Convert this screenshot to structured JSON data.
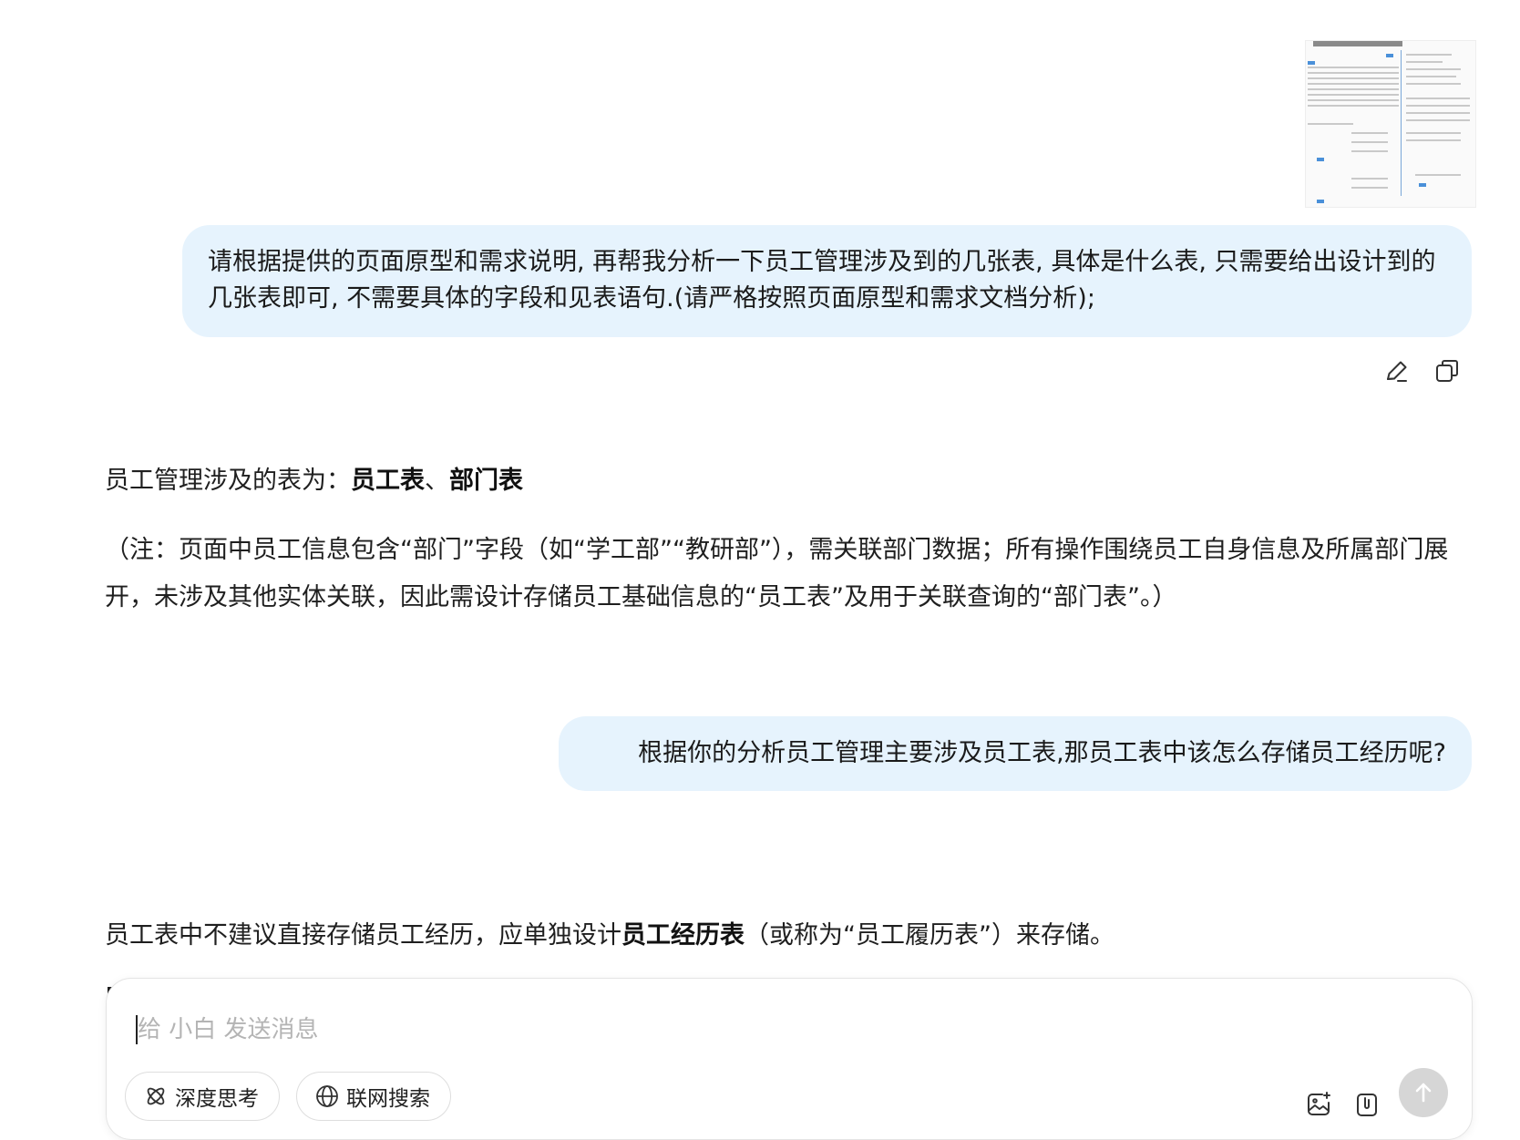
{
  "messages": {
    "user1": "请根据提供的页面原型和需求说明, 再帮我分析一下员工管理涉及到的几张表, 具体是什么表, 只需要给出设计到的几张表即可, 不需要具体的字段和见表语句.(请严格按照页面原型和需求文档分析);",
    "answer1_prefix": "员工管理涉及的表为：",
    "answer1_bold1": "员工表",
    "answer1_sep": "、",
    "answer1_bold2": "部门表",
    "answer1_note": "（注：页面中员工信息包含“部门”字段（如“学工部”“教研部”），需关联部门数据；所有操作围绕员工自身信息及所属部门展开，未涉及其他实体关联，因此需设计存储员工基础信息的“员工表”及用于关联查询的“部门表”。）",
    "user2": "根据你的分析员工管理主要涉及员工表,那员工表中该怎么存储员工经历呢?",
    "answer2_prefix": "员工表中不建议直接存储员工经历，应单独设计",
    "answer2_bold": "员工经历表",
    "answer2_suffix": "（或称为“员工履历表”）来存储。"
  },
  "actions": {
    "edit_icon": "edit-icon",
    "copy_icon": "copy-icon"
  },
  "composer": {
    "placeholder": "给 小白 发送消息",
    "deep_think": "深度思考",
    "web_search": "联网搜索",
    "image_icon": "image-add-icon",
    "attach_icon": "attach-icon",
    "send_icon": "arrow-up-icon"
  },
  "colors": {
    "user_bubble": "#e6f3fd",
    "send_button": "#d6d6d6"
  }
}
